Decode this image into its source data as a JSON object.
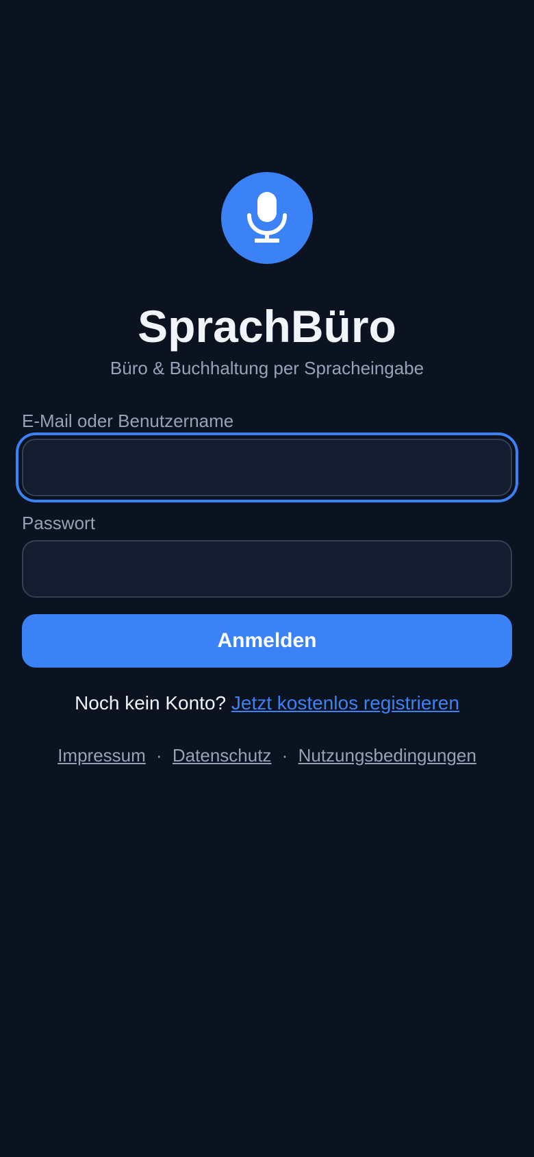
{
  "app": {
    "logo_icon": "microphone-icon",
    "title": "SprachBüro",
    "subtitle": "Büro & Buchhaltung per Spracheingabe"
  },
  "form": {
    "email_label": "E-Mail oder Benutzername",
    "email_value": "",
    "password_label": "Passwort",
    "password_value": "",
    "submit_label": "Anmelden"
  },
  "signup": {
    "prompt": "Noch kein Konto?",
    "link": "Jetzt kostenlos registrieren"
  },
  "footer": {
    "links": [
      "Impressum",
      "Datenschutz",
      "Nutzungsbedingungen"
    ],
    "separator": "·"
  },
  "colors": {
    "background": "#0b1220",
    "accent": "#3b82f6",
    "input_bg": "#141d2f",
    "muted_text": "#94a3b8"
  }
}
